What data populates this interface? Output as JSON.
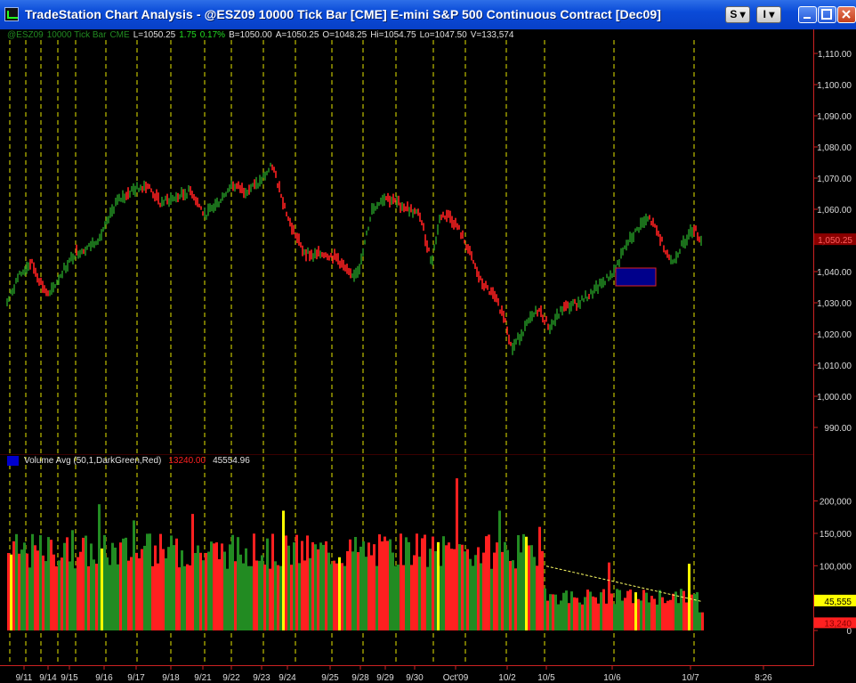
{
  "window": {
    "title": "TradeStation Chart Analysis - @ESZ09 10000 Tick Bar [CME] E-mini S&P 500 Continuous Contract [Dec09]",
    "buttons": {
      "s_menu": "S",
      "i_menu": "I"
    }
  },
  "price_pane": {
    "symbol": "@ESZ09",
    "interval": "10000 Tick Bar",
    "exchange": "CME",
    "last": "L=1050.25",
    "net_change": "1.75",
    "pct_change": "0.17%",
    "bid": "B=1050.00",
    "ask": "A=1050.25",
    "open": "O=1048.25",
    "high": "Hi=1054.75",
    "low": "Lo=1047.50",
    "volume": "V=133,574",
    "axis_labels": [
      "1,110.00",
      "1,100.00",
      "1,090.00",
      "1,080.00",
      "1,070.00",
      "1,060.00",
      "1,050.00",
      "1,040.00",
      "1,030.00",
      "1,020.00",
      "1,010.00",
      "1,000.00",
      "990.00"
    ],
    "last_price_marker": "1,050.25",
    "colors": {
      "up": "#228b22",
      "down": "#ff2020",
      "box": "#00008b"
    }
  },
  "volume_pane": {
    "indicator": "Volume Avg (50,1,DarkGreen,Red)",
    "value1": "13240.00",
    "value2": "45554.96",
    "axis_labels": [
      "200,000",
      "150,000",
      "100,000",
      "50,000",
      "0"
    ],
    "markers": {
      "avg": "45,555",
      "current": "13,240"
    }
  },
  "time_axis": {
    "labels": [
      "9/11",
      "9/14",
      "9/15",
      "9/16",
      "9/17",
      "9/18",
      "9/21",
      "9/22",
      "9/23",
      "9/24",
      "9/25",
      "9/28",
      "9/29",
      "9/30",
      "Oct'09",
      "10/2",
      "10/5",
      "10/6",
      "10/7",
      "8:26"
    ]
  },
  "chart_data": {
    "type": "line",
    "title": "@ESZ09 10000 Tick Bar [CME] E-mini S&P 500 Continuous Contract [Dec09]",
    "price_series": {
      "name": "@ESZ09",
      "x": [
        "9/11",
        "9/14",
        "9/15",
        "9/16",
        "9/17",
        "9/18",
        "9/21",
        "9/22",
        "9/23",
        "9/24",
        "9/25",
        "9/28",
        "9/29",
        "9/30",
        "Oct'09",
        "10/2",
        "10/5",
        "10/6",
        "10/7"
      ],
      "values": [
        1033,
        1040,
        1044,
        1052,
        1065,
        1064,
        1058,
        1066,
        1070,
        1050,
        1043,
        1040,
        1062,
        1055,
        1052,
        1022,
        1028,
        1040,
        1050.25
      ],
      "ylim": [
        985,
        1112
      ]
    },
    "volume_series": {
      "name": "Volume Avg (50,1,DarkGreen,Red)",
      "x": [
        "9/11",
        "9/14",
        "9/15",
        "9/16",
        "9/17",
        "9/18",
        "9/21",
        "9/22",
        "9/23",
        "9/24",
        "9/25",
        "9/28",
        "9/29",
        "9/30",
        "Oct'09",
        "10/2",
        "10/5",
        "10/6",
        "10/7"
      ],
      "values": [
        110000,
        115000,
        120000,
        130000,
        140000,
        120000,
        125000,
        120000,
        135000,
        120000,
        115000,
        110000,
        130000,
        115000,
        120000,
        125000,
        55000,
        65000,
        13240
      ],
      "ylim": [
        0,
        230000
      ]
    }
  }
}
